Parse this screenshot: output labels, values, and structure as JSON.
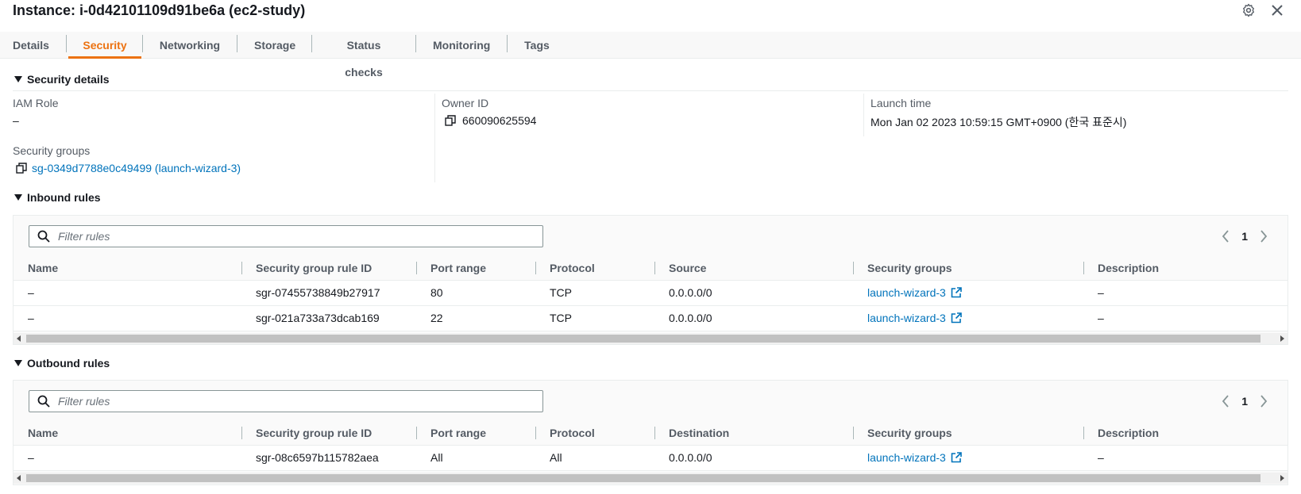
{
  "header": {
    "title": "Instance: i-0d42101109d91be6a (ec2-study)",
    "icons": [
      "gear-icon",
      "close-icon"
    ]
  },
  "tabs": [
    {
      "label": "Details",
      "active": false
    },
    {
      "label": "Security",
      "active": true
    },
    {
      "label": "Networking",
      "active": false
    },
    {
      "label": "Storage",
      "active": false
    },
    {
      "label": "Status checks",
      "active": false
    },
    {
      "label": "Monitoring",
      "active": false
    },
    {
      "label": "Tags",
      "active": false
    }
  ],
  "security_details": {
    "title": "Security details",
    "iam_role_label": "IAM Role",
    "iam_role_value": "–",
    "owner_id_label": "Owner ID",
    "owner_id_value": "660090625594",
    "launch_time_label": "Launch time",
    "launch_time_value": "Mon Jan 02 2023 10:59:15 GMT+0900 (한국 표준시)",
    "security_groups_label": "Security groups",
    "security_groups_value": "sg-0349d7788e0c49499 (launch-wizard-3)"
  },
  "inbound": {
    "title": "Inbound rules",
    "filter_placeholder": "Filter rules",
    "page": "1",
    "columns": [
      "Name",
      "Security group rule ID",
      "Port range",
      "Protocol",
      "Source",
      "Security groups",
      "Description"
    ],
    "rows": [
      [
        "–",
        "sgr-07455738849b27917",
        "80",
        "TCP",
        "0.0.0.0/0",
        "launch-wizard-3",
        "–"
      ],
      [
        "–",
        "sgr-021a733a73dcab169",
        "22",
        "TCP",
        "0.0.0.0/0",
        "launch-wizard-3",
        "–"
      ]
    ]
  },
  "outbound": {
    "title": "Outbound rules",
    "filter_placeholder": "Filter rules",
    "page": "1",
    "columns": [
      "Name",
      "Security group rule ID",
      "Port range",
      "Protocol",
      "Destination",
      "Security groups",
      "Description"
    ],
    "rows": [
      [
        "–",
        "sgr-08c6597b115782aea",
        "All",
        "All",
        "0.0.0.0/0",
        "launch-wizard-3",
        "–"
      ]
    ]
  },
  "colors": {
    "accent": "#ec7211",
    "link": "#0073bb",
    "text": "#16191f",
    "muted": "#545b64"
  }
}
